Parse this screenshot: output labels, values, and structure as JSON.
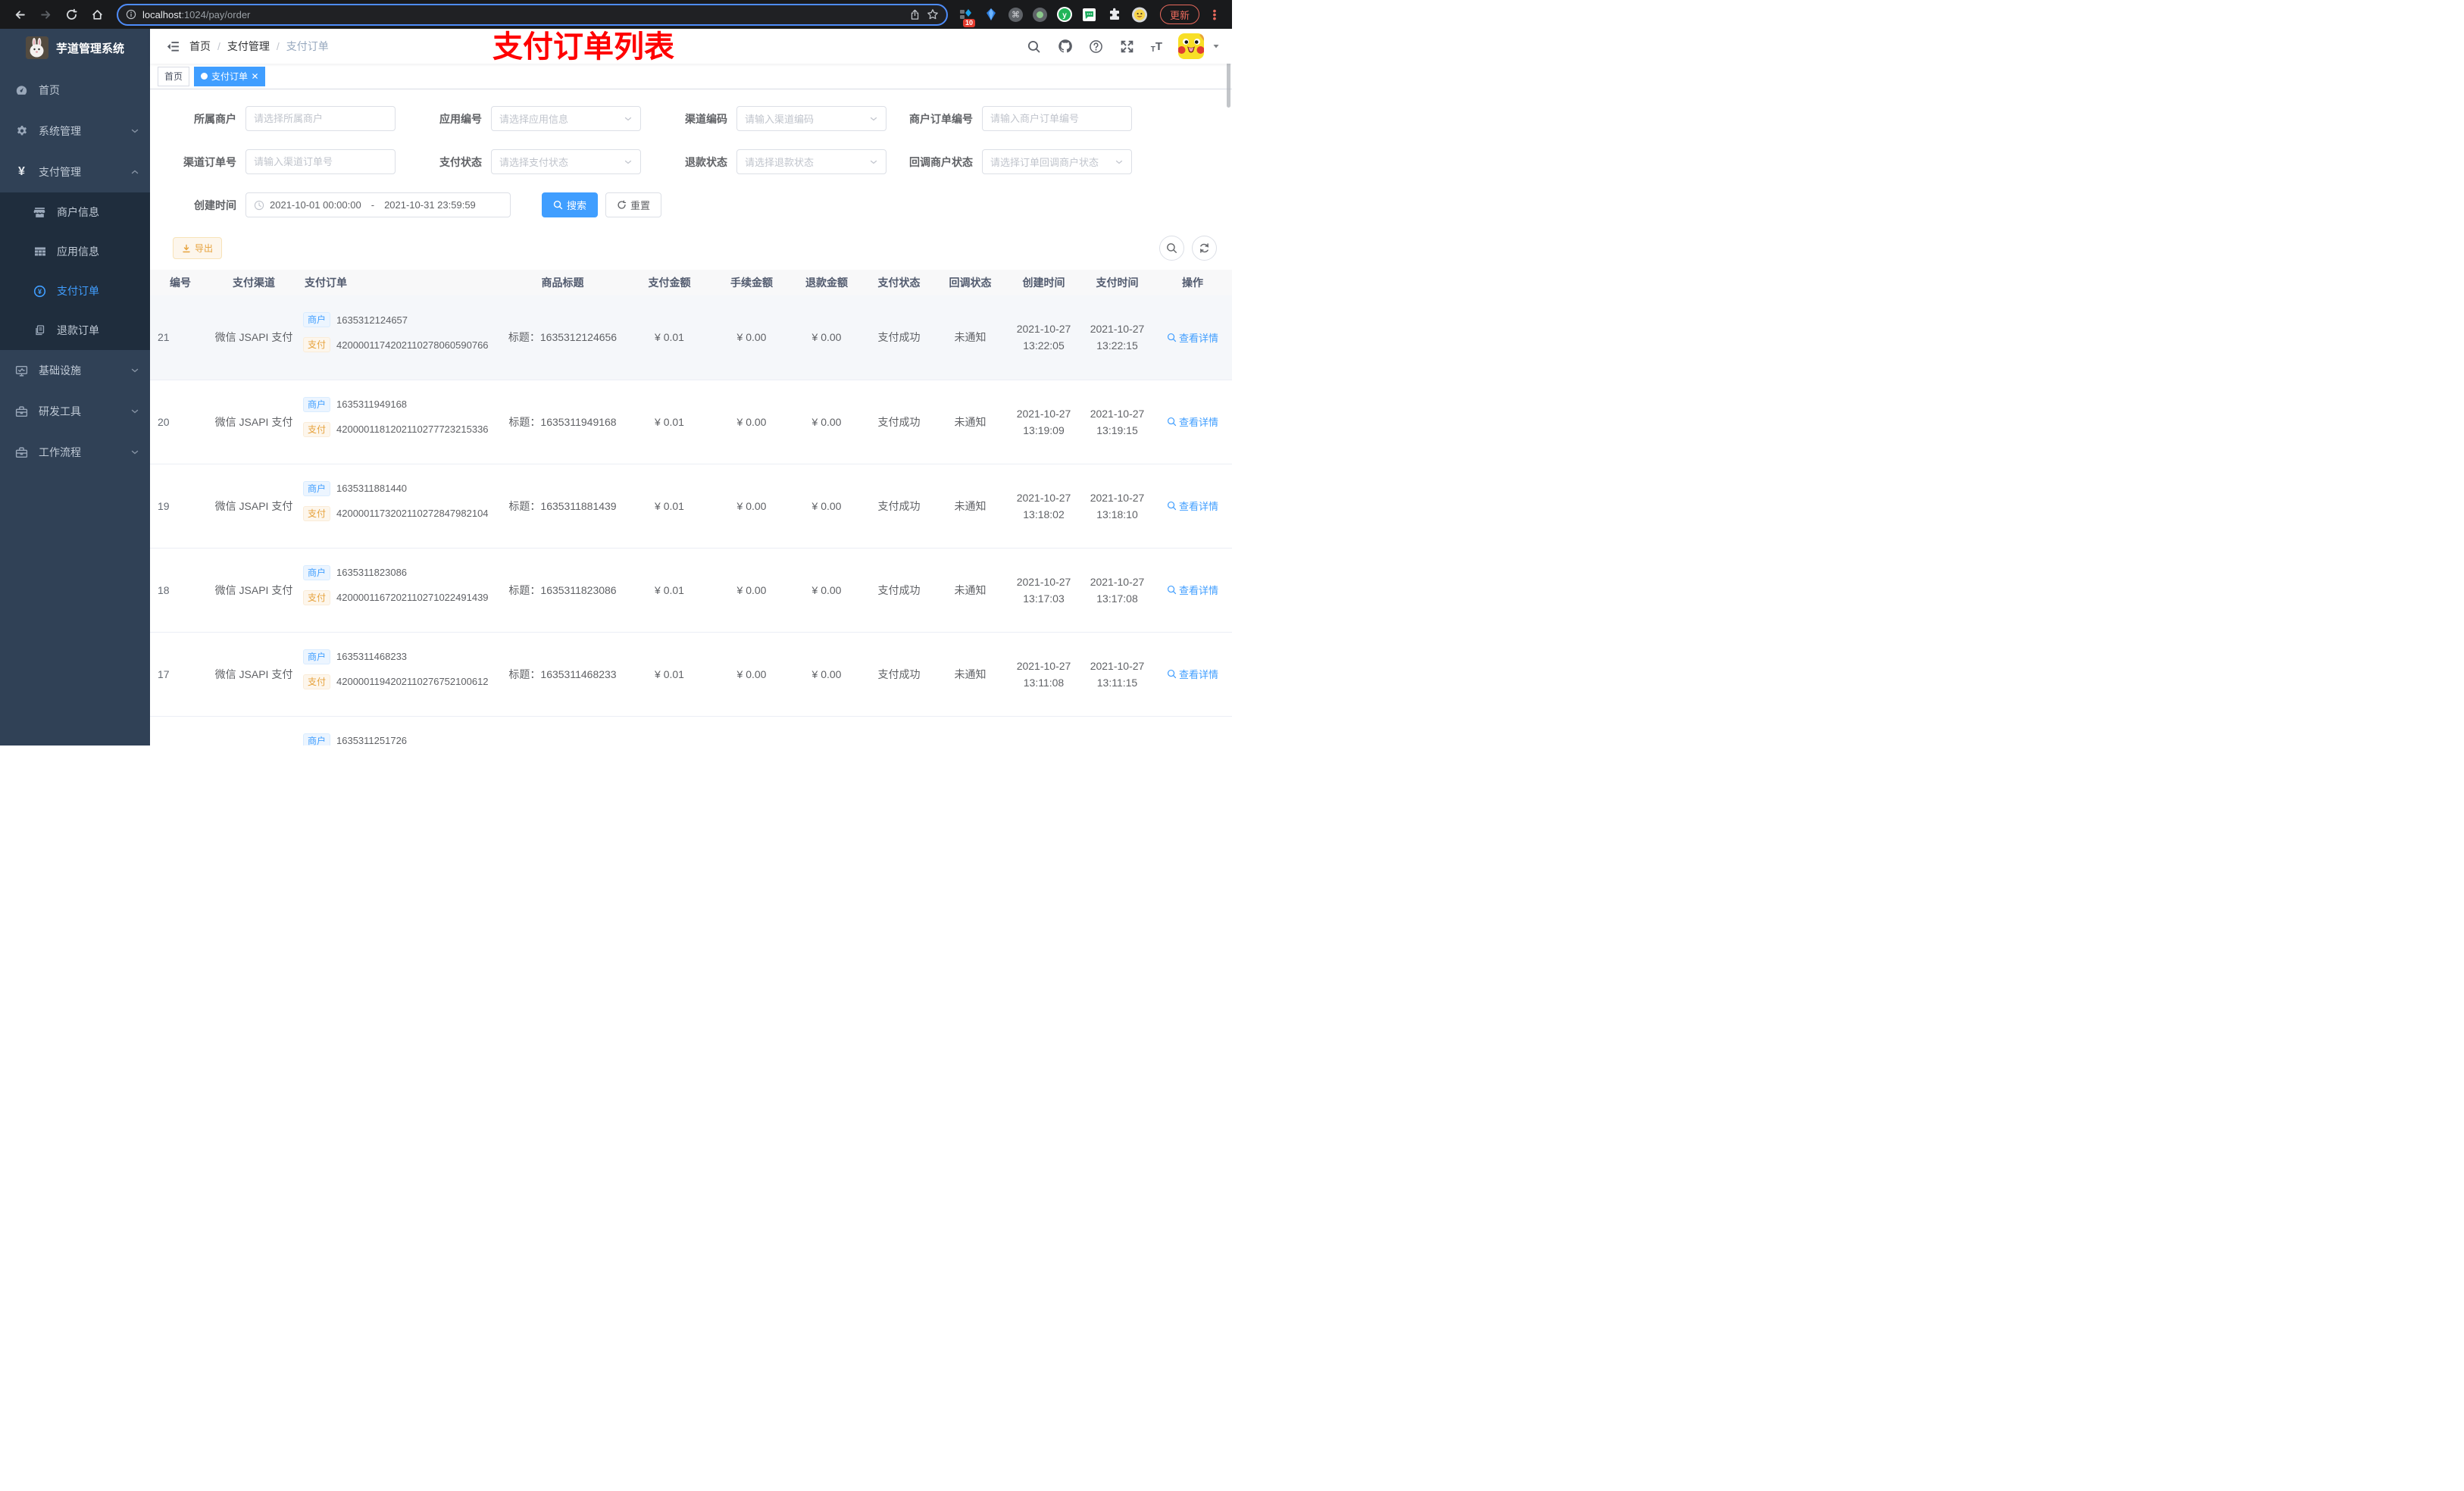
{
  "colors": {
    "accent": "#409eff",
    "warning": "#e6a23c",
    "annotation_red": "#ff0000",
    "sidebar_bg": "#304156",
    "submenu_bg": "#1f2d3d",
    "tab_active_bg": "#409eff"
  },
  "browser": {
    "url_host": "localhost",
    "url_path": ":1024/pay/order",
    "ext_badge": "10",
    "update_label": "更新"
  },
  "sidebar": {
    "app_title": "芋道管理系统",
    "menu": {
      "home": "首页",
      "system": "系统管理",
      "pay": "支付管理",
      "merchant_info": "商户信息",
      "app_info": "应用信息",
      "pay_order": "支付订单",
      "refund_order": "退款订单",
      "infra": "基础设施",
      "dev_tools": "研发工具",
      "workflow": "工作流程"
    }
  },
  "header": {
    "breadcrumb": {
      "home": "首页",
      "section": "支付管理",
      "current": "支付订单",
      "sep": "/"
    },
    "annotation": "支付订单列表"
  },
  "tabs": {
    "home": "首页",
    "active": "支付订单"
  },
  "filters": {
    "merchant": {
      "label": "所属商户",
      "placeholder": "请选择所属商户"
    },
    "app": {
      "label": "应用编号",
      "placeholder": "请选择应用信息"
    },
    "channel_code": {
      "label": "渠道编码",
      "placeholder": "请输入渠道编码"
    },
    "merchant_order_no": {
      "label": "商户订单编号",
      "placeholder": "请输入商户订单编号"
    },
    "channel_order_no": {
      "label": "渠道订单号",
      "placeholder": "请输入渠道订单号"
    },
    "pay_status": {
      "label": "支付状态",
      "placeholder": "请选择支付状态"
    },
    "refund_status": {
      "label": "退款状态",
      "placeholder": "请选择退款状态"
    },
    "notify_status": {
      "label": "回调商户状态",
      "placeholder": "请选择订单回调商户状态"
    },
    "create_time": {
      "label": "创建时间",
      "start": "2021-10-01 00:00:00",
      "sep": "-",
      "end": "2021-10-31 23:59:59"
    },
    "search_label": "搜索",
    "reset_label": "重置"
  },
  "toolbar": {
    "export_label": "导出"
  },
  "table": {
    "columns": [
      "编号",
      "支付渠道",
      "支付订单",
      "商品标题",
      "支付金额",
      "手续金额",
      "退款金额",
      "支付状态",
      "回调状态",
      "创建时间",
      "支付时间",
      "操作"
    ],
    "badge_merchant": "商户",
    "badge_pay": "支付",
    "action_label": "查看详情",
    "rows": [
      {
        "id": "21",
        "channel": "微信 JSAPI 支付",
        "merchant_no": "1635312124657",
        "pay_no": "4200001174202110278060590766",
        "title": "标题：1635312124656",
        "amount": "¥ 0.01",
        "fee": "¥ 0.00",
        "refund": "¥ 0.00",
        "pay_status": "支付成功",
        "notify_status": "未通知",
        "create_date": "2021-10-27",
        "create_time": "13:22:05",
        "pay_date": "2021-10-27",
        "pay_time": "13:22:15",
        "hover": true
      },
      {
        "id": "20",
        "channel": "微信 JSAPI 支付",
        "merchant_no": "1635311949168",
        "pay_no": "4200001181202110277723215336",
        "title": "标题：1635311949168",
        "amount": "¥ 0.01",
        "fee": "¥ 0.00",
        "refund": "¥ 0.00",
        "pay_status": "支付成功",
        "notify_status": "未通知",
        "create_date": "2021-10-27",
        "create_time": "13:19:09",
        "pay_date": "2021-10-27",
        "pay_time": "13:19:15"
      },
      {
        "id": "19",
        "channel": "微信 JSAPI 支付",
        "merchant_no": "1635311881440",
        "pay_no": "4200001173202110272847982104",
        "title": "标题：1635311881439",
        "amount": "¥ 0.01",
        "fee": "¥ 0.00",
        "refund": "¥ 0.00",
        "pay_status": "支付成功",
        "notify_status": "未通知",
        "create_date": "2021-10-27",
        "create_time": "13:18:02",
        "pay_date": "2021-10-27",
        "pay_time": "13:18:10"
      },
      {
        "id": "18",
        "channel": "微信 JSAPI 支付",
        "merchant_no": "1635311823086",
        "pay_no": "4200001167202110271022491439",
        "title": "标题：1635311823086",
        "amount": "¥ 0.01",
        "fee": "¥ 0.00",
        "refund": "¥ 0.00",
        "pay_status": "支付成功",
        "notify_status": "未通知",
        "create_date": "2021-10-27",
        "create_time": "13:17:03",
        "pay_date": "2021-10-27",
        "pay_time": "13:17:08"
      },
      {
        "id": "17",
        "channel": "微信 JSAPI 支付",
        "merchant_no": "1635311468233",
        "pay_no": "4200001194202110276752100612",
        "title": "标题：1635311468233",
        "amount": "¥ 0.01",
        "fee": "¥ 0.00",
        "refund": "¥ 0.00",
        "pay_status": "支付成功",
        "notify_status": "未通知",
        "create_date": "2021-10-27",
        "create_time": "13:11:08",
        "pay_date": "2021-10-27",
        "pay_time": "13:11:15"
      },
      {
        "id": "",
        "channel": "",
        "merchant_no": "1635311251726",
        "pay_no": "",
        "title": "",
        "amount": "",
        "fee": "",
        "refund": "",
        "pay_status": "",
        "notify_status": "",
        "create_date": "",
        "create_time": "",
        "pay_date": "",
        "pay_time": "",
        "partial": true
      }
    ]
  }
}
